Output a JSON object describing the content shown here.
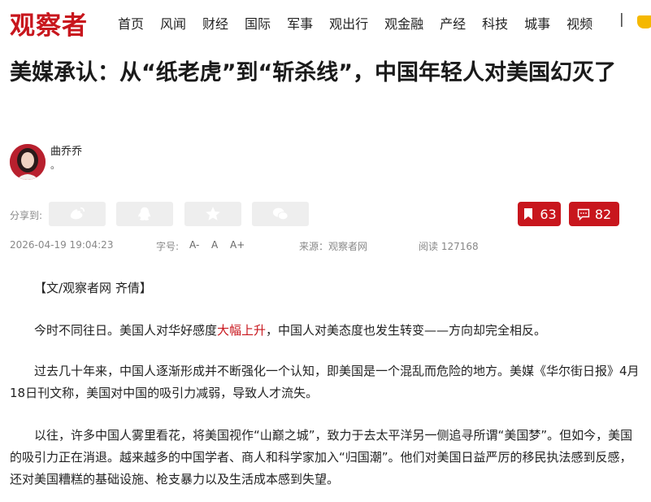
{
  "logo": "观察者",
  "nav": {
    "items": [
      "首页",
      "风闻",
      "财经",
      "国际",
      "军事",
      "观出行",
      "观金融",
      "产经",
      "科技",
      "城事",
      "视频"
    ],
    "separator": "|"
  },
  "article": {
    "title": "美媒承认：从“纸老虎”到“斩杀线”，中国年轻人对美国幻灭了",
    "author": {
      "name": "曲乔乔",
      "desc": "。"
    },
    "share_label": "分享到:",
    "share_icons": [
      "weibo-icon",
      "qq-icon",
      "qzone-icon",
      "wechat-icon"
    ],
    "bookmark_count": "63",
    "comment_count": "82",
    "date": "2026-04-19 19:04:23",
    "font_size_label": "字号:",
    "font_size_controls": [
      "A-",
      "A",
      "A+"
    ],
    "source": "来源：观察者网",
    "reads": "阅读 127168",
    "byline": "【文/观察者网 齐倩】",
    "p1_before": "今时不同往日。美国人对华好感度",
    "p1_link": "大幅上升",
    "p1_after": "，中国人对美态度也发生转变——方向却完全相反。",
    "p2": "过去几十年来，中国人逐渐形成并不断强化一个认知，即美国是一个混乱而危险的地方。美媒《华尔街日报》4月18日刊文称，美国对中国的吸引力减弱，导致人才流失。",
    "p3": "以往，许多中国人雾里看花，将美国视作“山巅之城”，致力于去太平洋另一侧追寻所谓“美国梦”。但如今，美国的吸引力正在消退。越来越多的中国学者、商人和科学家加入“归国潮”。他们对美国日益严厉的移民执法感到反感，还对美国糟糕的基础设施、枪支暴力以及生活成本感到失望。"
  },
  "colors": {
    "brand_red": "#c8161d",
    "button_gray": "#eeeeee"
  }
}
